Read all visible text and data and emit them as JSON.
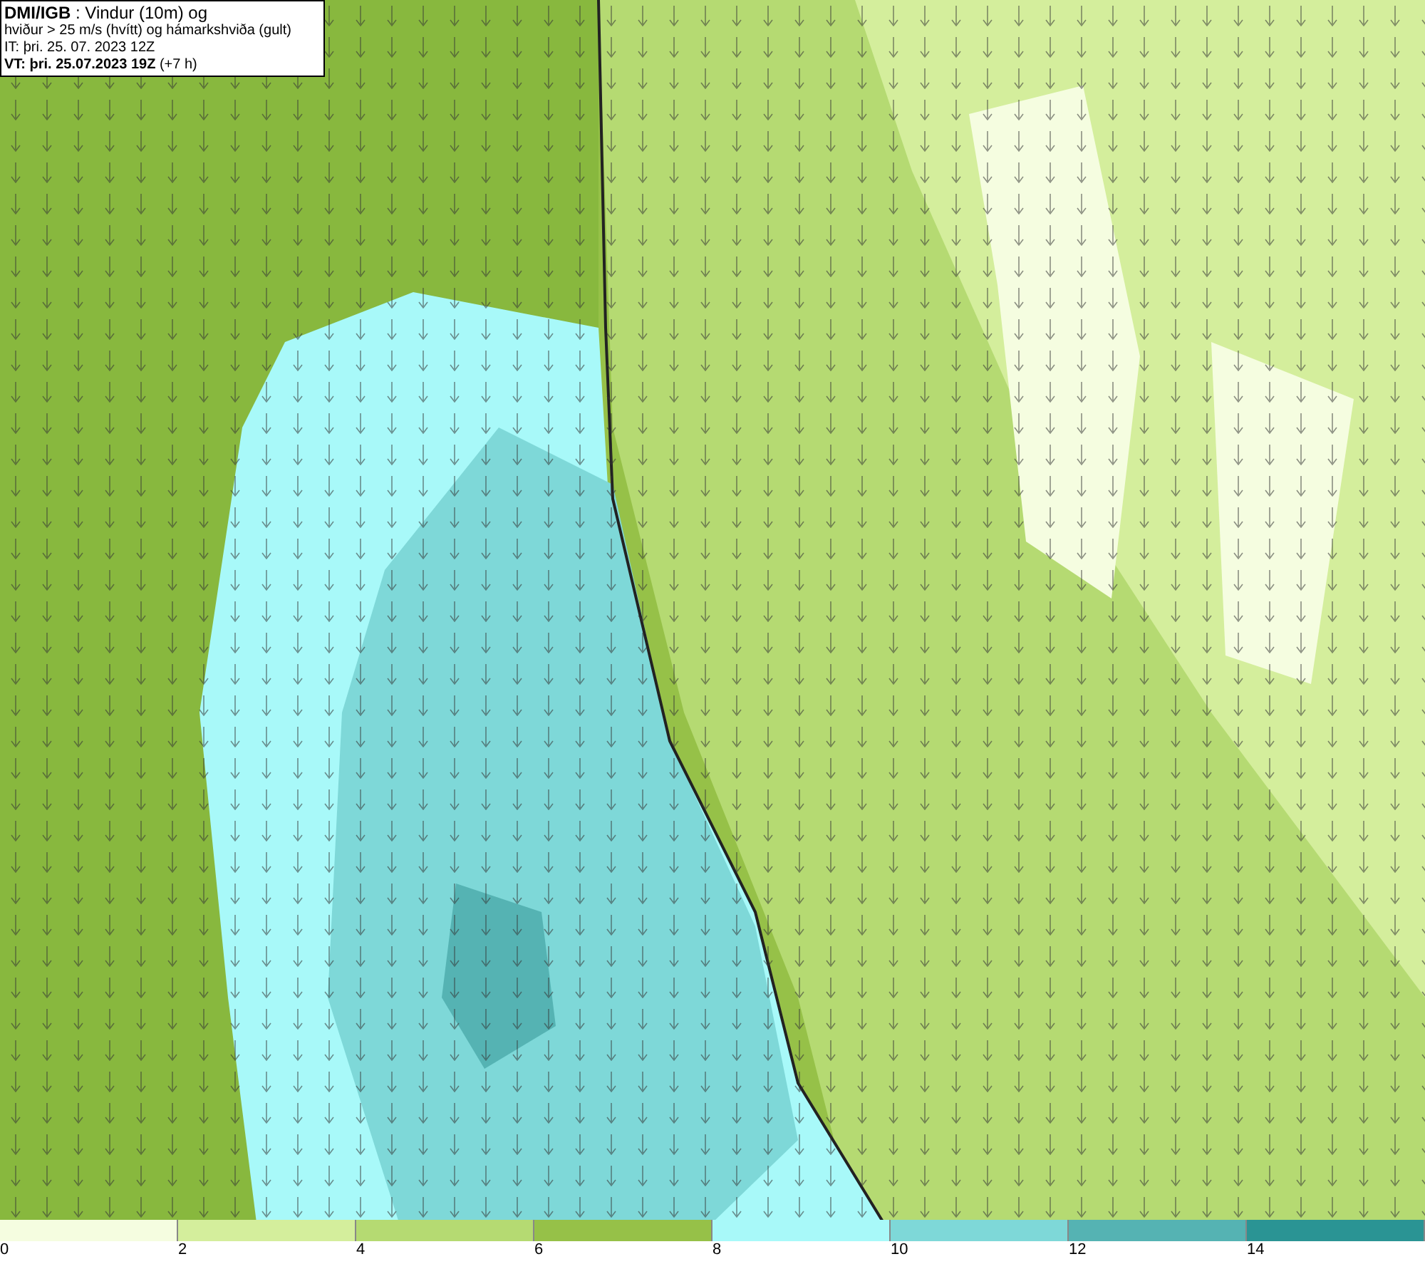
{
  "header": {
    "lines": [
      "**DMI/IGB** : Vindur (10m) og",
      "hviður > 25 m/s (hvítt) og hámarkshviða (gult)",
      "IT: þri. 25. 07. 2023 12Z",
      "**VT: þri. 25.07.2023 19Z** (+7 h)"
    ]
  },
  "legend": [
    {
      "color": "#f5fde0",
      "label": "0"
    },
    {
      "color": "#d4ee9c",
      "label": "2"
    },
    {
      "color": "#b5da72",
      "label": "4"
    },
    {
      "color": "#96c148",
      "label": "6"
    },
    {
      "color": "#a8f9f9",
      "label": "8"
    },
    {
      "color": "#7ed8d8",
      "label": "10"
    },
    {
      "color": "#55b3b3",
      "label": "12"
    },
    {
      "color": "#2a9494",
      "label": "14"
    }
  ]
}
